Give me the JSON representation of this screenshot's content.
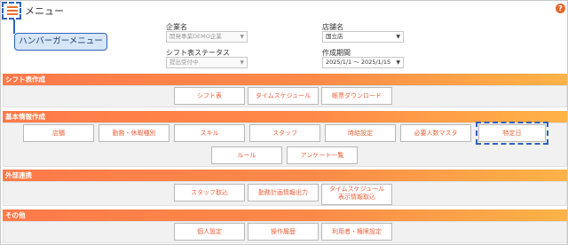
{
  "header": {
    "title": "メニュー",
    "callout": "ハンバーガーメニュー",
    "help": "?"
  },
  "filters": {
    "company_label": "企業名",
    "company_value": "開発事業DEMO企業",
    "store_label": "店舗名",
    "store_value": "国立店",
    "status_label": "シフト表ステータス",
    "status_value": "提出受付中",
    "period_label": "作成期間",
    "period_value": "2025/1/1 ～ 2025/1/15"
  },
  "sections": {
    "shift": {
      "title": "シフト表作成",
      "buttons": [
        "シフト表",
        "タイムスケジュール",
        "帳票ダウンロード"
      ]
    },
    "basic": {
      "title": "基本情報作成",
      "buttons": [
        "店舗",
        "勤務・休暇種別",
        "スキル",
        "スタッフ",
        "時給設定",
        "必要人数マスタ",
        "特定日",
        "ルール",
        "アンケート一覧"
      ]
    },
    "external": {
      "title": "外部連携",
      "buttons": [
        "スタッフ取込",
        "勤務計画情報出力",
        "タイムスケジュール",
        "表示情報取込"
      ]
    },
    "other": {
      "title": "その他",
      "buttons": [
        "個人設定",
        "操作履歴",
        "利用者・権限設定"
      ]
    }
  },
  "colors": {
    "accent": "#e8623a",
    "bar_start": "#ff7a4a",
    "bar_end": "#ffb347",
    "highlight": "#2f62b8"
  }
}
